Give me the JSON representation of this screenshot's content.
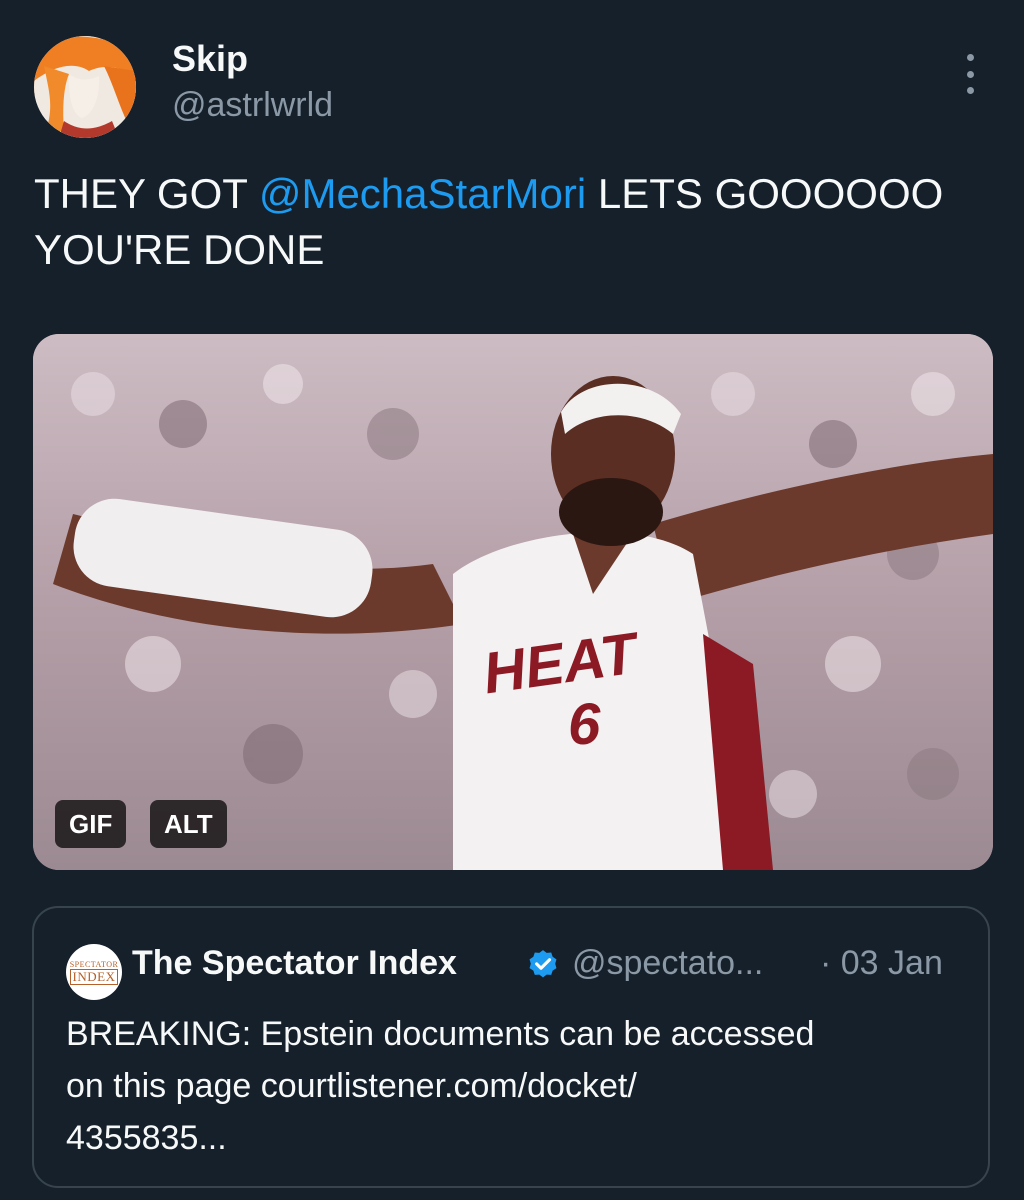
{
  "author": {
    "name": "Skip",
    "handle": "@astrlwrld",
    "avatar_icon": "anime-character-avatar"
  },
  "more_icon": "more-vertical-icon",
  "tweet": {
    "text_before": "THEY GOT ",
    "mention": "@MechaStarMori",
    "text_after": " LETS GOOOOOO YOU'RE DONE"
  },
  "media": {
    "description_icon": "basketball-celebration-gif",
    "jersey_text": "HEAT",
    "jersey_number": "6",
    "gif_badge": "GIF",
    "alt_badge": "ALT"
  },
  "quote": {
    "avatar_text_top": "SPECTATOR",
    "avatar_text_main": "INDEX",
    "name": "The Spectator Index",
    "verified_icon": "verified-badge-icon",
    "handle": "@spectato...",
    "date": "· 03 Jan",
    "text_lines": [
      "BREAKING: Epstein documents can be accessed",
      "on this page courtlistener.com/docket/",
      "4355835..."
    ]
  },
  "colors": {
    "background": "#15202b",
    "text": "#f7f9f9",
    "secondary": "#8b98a5",
    "link": "#1d9bf0",
    "border": "#38444d",
    "verified": "#1d9bf0"
  }
}
